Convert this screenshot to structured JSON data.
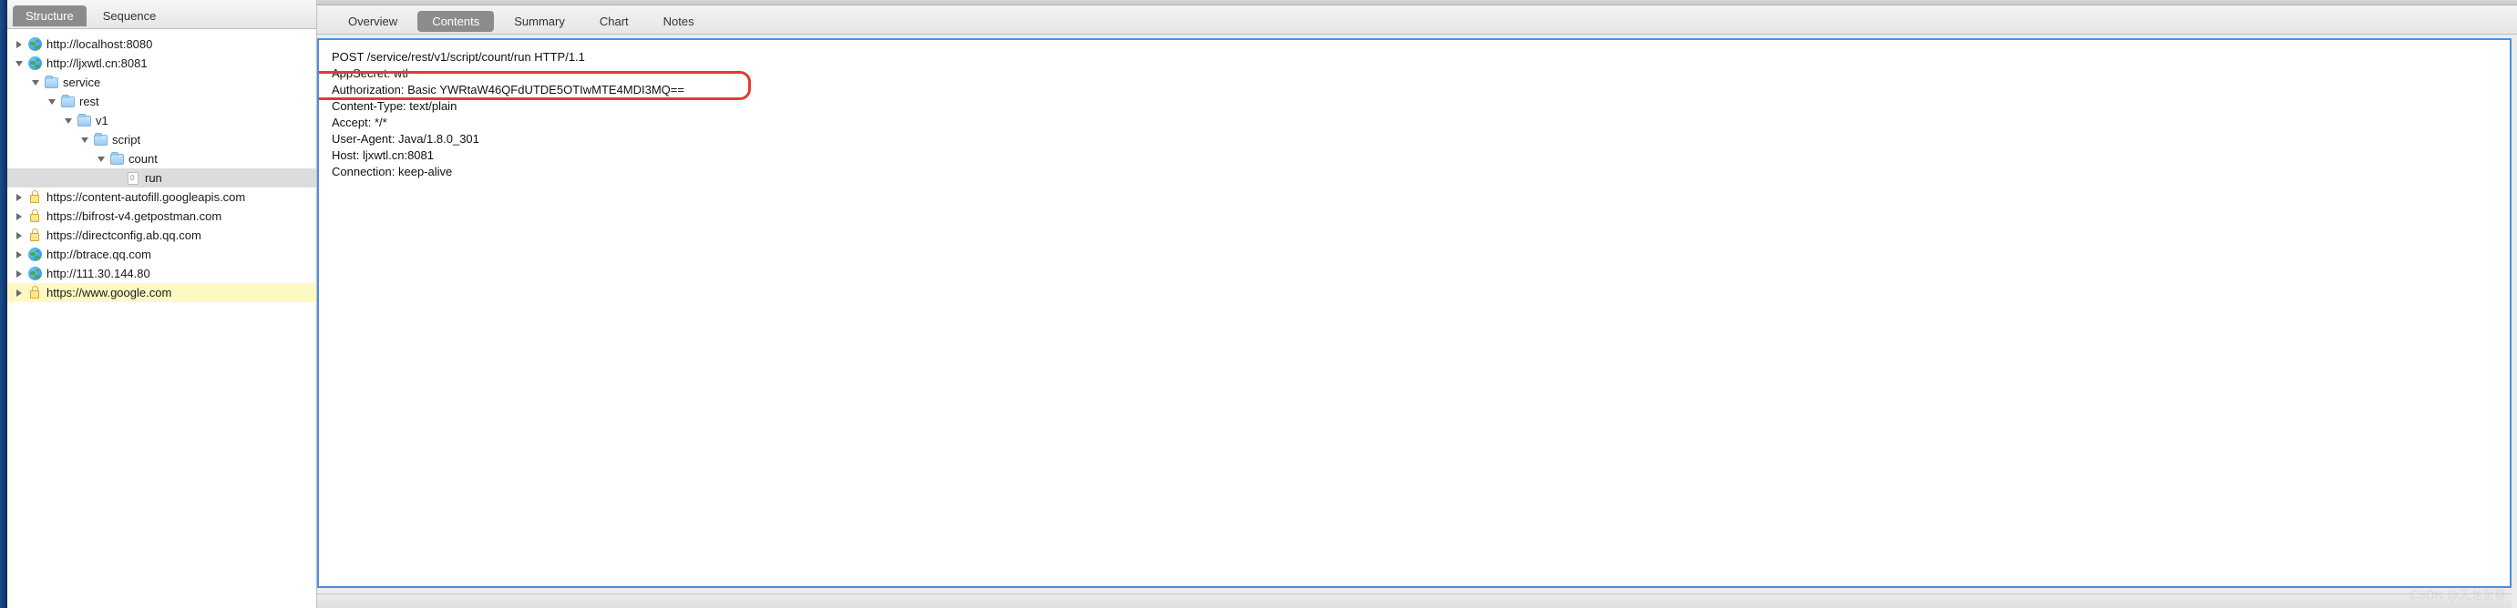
{
  "sidebar": {
    "tabs": [
      {
        "label": "Structure",
        "active": true
      },
      {
        "label": "Sequence",
        "active": false
      }
    ],
    "tree": [
      {
        "depth": 0,
        "arrow": "right",
        "icon": "globe",
        "label": "http://localhost:8080"
      },
      {
        "depth": 0,
        "arrow": "down",
        "icon": "globe",
        "label": "http://ljxwtl.cn:8081"
      },
      {
        "depth": 1,
        "arrow": "down",
        "icon": "folder",
        "label": "service"
      },
      {
        "depth": 2,
        "arrow": "down",
        "icon": "folder",
        "label": "rest"
      },
      {
        "depth": 3,
        "arrow": "down",
        "icon": "folder",
        "label": "v1"
      },
      {
        "depth": 4,
        "arrow": "down",
        "icon": "folder",
        "label": "script"
      },
      {
        "depth": 5,
        "arrow": "down",
        "icon": "folder",
        "label": "count"
      },
      {
        "depth": 6,
        "arrow": "none",
        "icon": "file",
        "label": "run",
        "selected": true
      },
      {
        "depth": 0,
        "arrow": "right",
        "icon": "lock",
        "label": "https://content-autofill.googleapis.com"
      },
      {
        "depth": 0,
        "arrow": "right",
        "icon": "lock",
        "label": "https://bifrost-v4.getpostman.com"
      },
      {
        "depth": 0,
        "arrow": "right",
        "icon": "lock",
        "label": "https://directconfig.ab.qq.com"
      },
      {
        "depth": 0,
        "arrow": "right",
        "icon": "globe",
        "label": "http://btrace.qq.com"
      },
      {
        "depth": 0,
        "arrow": "right",
        "icon": "globe",
        "label": "http://111.30.144.80"
      },
      {
        "depth": 0,
        "arrow": "right",
        "icon": "lock",
        "label": "https://www.google.com",
        "highlighted": true
      }
    ]
  },
  "main": {
    "tabs": [
      {
        "label": "Overview",
        "active": false
      },
      {
        "label": "Contents",
        "active": true
      },
      {
        "label": "Summary",
        "active": false
      },
      {
        "label": "Chart",
        "active": false
      },
      {
        "label": "Notes",
        "active": false
      }
    ],
    "request": {
      "line": "POST /service/rest/v1/script/count/run HTTP/1.1",
      "headers": [
        "AppSecret: wtl",
        "Authorization: Basic YWRtaW46QFdUTDE5OTIwMTE4MDI3MQ==",
        "Content-Type: text/plain",
        "Accept: */*",
        "User-Agent: Java/1.8.0_301",
        "Host: ljxwtl.cn:8081",
        "Connection: keep-alive"
      ],
      "highlight_index": 1
    }
  },
  "watermark": "CSDN @天龙至尊"
}
